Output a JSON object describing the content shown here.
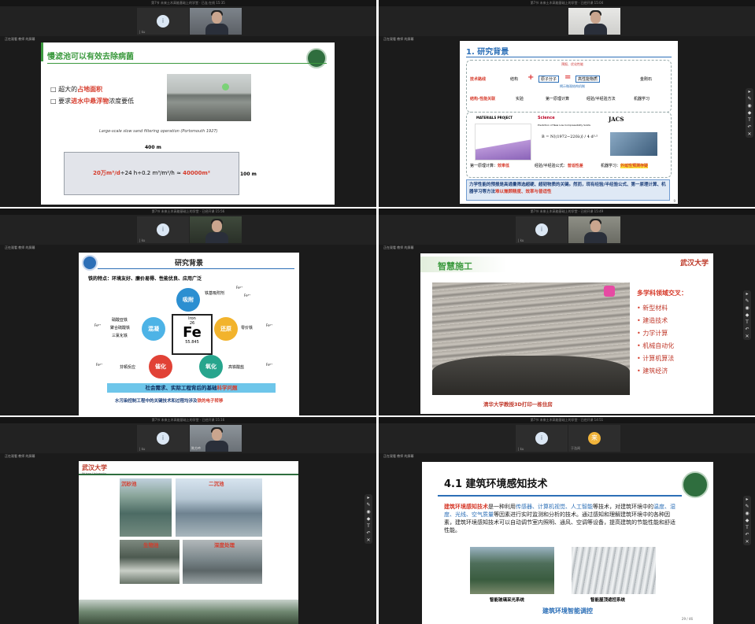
{
  "tiles": [
    {
      "title": "第7节 未来土木高能基础上的学堂 · 已连 在线 15:35",
      "participant_name": "| ku",
      "avatar_letter": "i",
      "status": "正在观看 教师 的屏幕",
      "cam_name": ""
    },
    {
      "title": "第7节 未来土木高能基础上的学堂 · 已经开课 15:04",
      "participant_name": "",
      "avatar_letter": "",
      "status": "正在观看 教师 的屏幕",
      "cam_name": ""
    },
    {
      "title": "第7节 未来土木高能基础上的学堂 · 已经开课 15:56",
      "participant_name": "| ku",
      "avatar_letter": "i",
      "status": "正在观看 教师 的屏幕",
      "cam_name": ""
    },
    {
      "title": "第7节 未来土木高能基础上的学堂 · 已经开课 15:49",
      "participant_name": "| ku",
      "avatar_letter": "i",
      "status": "正在观看 教师 的屏幕",
      "cam_name": ""
    },
    {
      "title": "第7节 未来土木高能基础上的学堂 · 已经开课 15:16",
      "participant_name": "| ku",
      "avatar_letter": "i",
      "status": "正在观看 教师 的屏幕",
      "cam_name": "陈方吟"
    },
    {
      "title": "第7节 未来土木高能基础上的学堂 · 已经开课 14:51",
      "participant_name": "| ku",
      "avatar_letter": "i",
      "status": "正在观看 教师 的屏幕",
      "cam_name": "于浩闻",
      "avatar2_letter": "来"
    }
  ],
  "slide1": {
    "title": "慢滤池可以有效去除病菌",
    "bullet1_pre": "超大的",
    "bullet1_hl": "占地面积",
    "bullet2_pre": "要求",
    "bullet2_hl": "进水中悬浮物",
    "bullet2_post": "浓度要低",
    "caption": "Large-scale slow sand filtering operation (Portsmouth 1927)",
    "dim_top": "400 m",
    "dim_right": "100 m",
    "formula_left": "20万m³/d",
    "formula_mid": "÷24 h÷0.2 m³/m²/h ≈",
    "formula_right": "40000m²"
  },
  "slide2": {
    "title": "1. 研究背景",
    "row1_label": "技术路线",
    "row1_items": [
      "结构",
      "原子分子",
      "高性能物质",
      "金刚石"
    ],
    "row1_note": "预报、优化性能",
    "row1_note2": "揭示微观结构机制",
    "row2_label": "结构-性能关联",
    "row2_items": [
      "实验",
      "第一原理计算",
      "经验/半经验方法",
      "机器学习"
    ],
    "cap1": "第一原理计算：",
    "cap1_hl": "效率低",
    "cap2": "经验/半经验公式：",
    "cap2_hl": "普适性差",
    "cap3": "机器学习：",
    "cap3_hl": "外延性预测存疑",
    "logo1": "MATERIALS PROJECT",
    "logo2": "Science",
    "logo3": "JACS",
    "paper_title": "Prediction of New Low Compressibility Solids",
    "summary_pre": "力学性能的预报是高通量筛选超硬、超韧物质的关键。然而，现有经验/半经验公式、第一原理计算、机器学习等方法",
    "summary_hl": "难以兼顾精度、效率与普适性",
    "page": "9"
  },
  "slide3": {
    "title": "研究背景",
    "intro": "铁的特点：环境友好、廉价易得、性能优良、应用广泛",
    "element_name": "Iron",
    "element_num": "26",
    "element_sym": "Fe",
    "element_mass": "55.845",
    "circles": [
      "吸附",
      "还原",
      "氧化",
      "催化",
      "混凝"
    ],
    "labels": [
      "铁基吸附剂",
      "零价铁",
      "高铁酸盐",
      "芬顿反应",
      "硝酸亚铁",
      "聚合硫酸铁",
      "三氯化铁"
    ],
    "ions": [
      "Fe²⁺",
      "Fe³⁺",
      "Fe⁶⁺"
    ],
    "banner_pre": "社会需求、实际工程背后的基础",
    "banner_hl": "科学问题",
    "footer_pre": "水污染控制工程中的关键技术和过程均涉及",
    "footer_hl": "铁的电子转移"
  },
  "slide4": {
    "title": "智慧施工",
    "logo": "武汉大学",
    "heading": "多学科领域交叉：",
    "items": [
      "新型材料",
      "建造技术",
      "力学计算",
      "机械自动化",
      "计算机算法",
      "建筑经济"
    ],
    "caption": "清华大学教授3D打印一栋住房"
  },
  "slide5": {
    "logo": "武汉大学",
    "logo_en": "Wuhan University",
    "labels": [
      "沉砂池",
      "二沉池",
      "生物池",
      "深度处理"
    ]
  },
  "slide6": {
    "title": "4.1 建筑环境感知技术",
    "p_hl1": "建筑环境感知技术",
    "p_t1": "是一种利用",
    "p_hl2": "传感器、计算机视觉、人工智能",
    "p_t2": "等技术，对建筑环境中的",
    "p_hl3": "温度、湿度、光线、空气质量",
    "p_t3": "等因素进行实时监测和分析的技术。通过感知和理解建筑环境中的各种因素，建筑环境感知技术可以自动调节室内照明、通风、空调等设备，提高建筑的节能性能和舒适性能。",
    "img1_caption": "智能玻璃采光系统",
    "img2_caption": "智能屋顶遮控系统",
    "bottom": "建筑环境智能调控",
    "page": "29 / 46"
  },
  "colors": {
    "bg": "#1b1b1b",
    "green": "#3c9a3f",
    "red": "#d63b2b",
    "blue": "#2c6fb7"
  }
}
